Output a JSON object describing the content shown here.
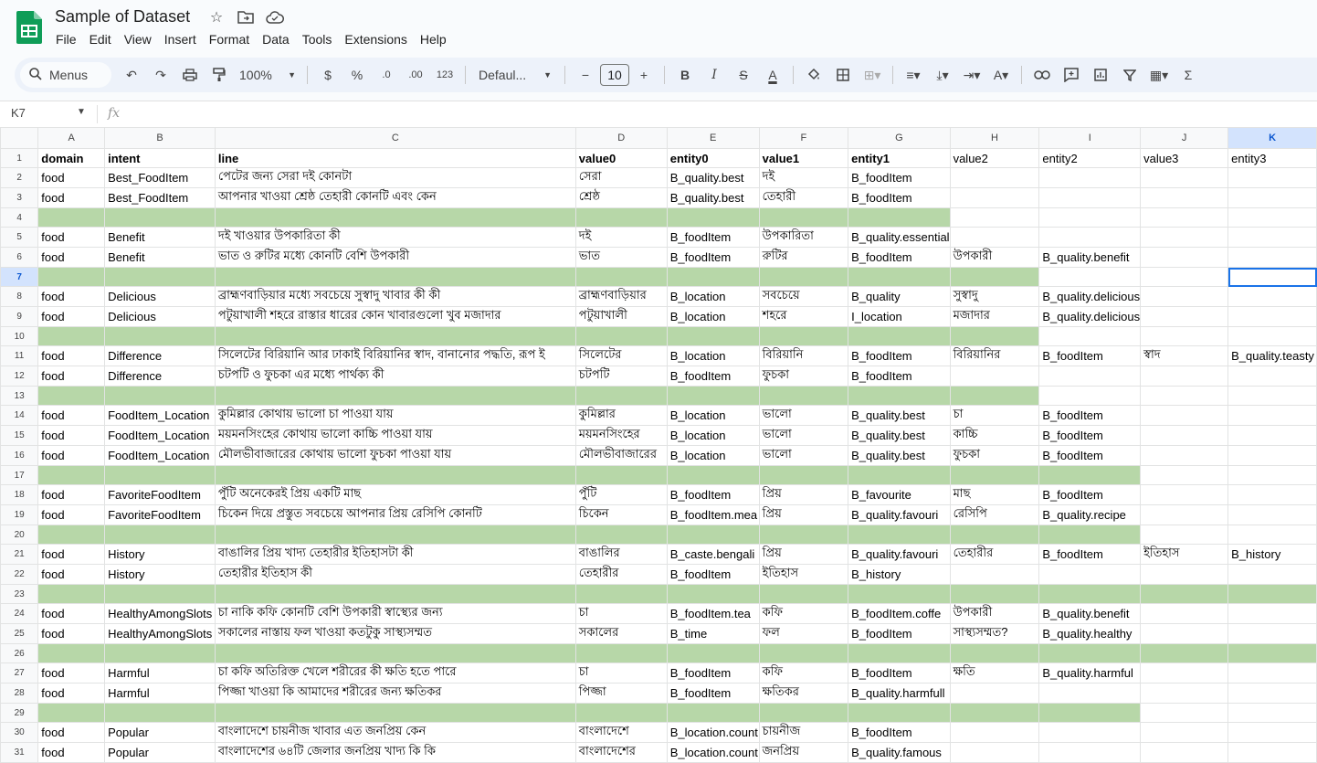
{
  "app": {
    "title": "Sample of Dataset",
    "menus": [
      "File",
      "Edit",
      "View",
      "Insert",
      "Format",
      "Data",
      "Tools",
      "Extensions",
      "Help"
    ]
  },
  "toolbar": {
    "search_label": "Menus",
    "zoom": "100%",
    "currency": "$",
    "percent": "%",
    "dec_decrease": ".0",
    "dec_increase": ".00",
    "number_format": "123",
    "font": "Defaul...",
    "font_size": "10",
    "bold": "B",
    "italic": "I",
    "strike": "S",
    "text_color": "A",
    "sum": "Σ"
  },
  "formula_bar": {
    "cell_ref": "K7",
    "fx": "fx",
    "value": ""
  },
  "grid": {
    "columns": [
      "A",
      "B",
      "C",
      "D",
      "E",
      "F",
      "G",
      "H",
      "I",
      "J",
      "K"
    ],
    "selected_column": "K",
    "selected_row": "7",
    "rows": [
      {
        "n": "1",
        "cells": [
          "domain",
          "intent",
          "line",
          "value0",
          "entity0",
          "value1",
          "entity1",
          "value2",
          "entity2",
          "value3",
          "entity3"
        ]
      },
      {
        "n": "2",
        "cells": [
          "food",
          "Best_FoodItem",
          "পেটের জন্য সেরা দই কোনটা",
          "সেরা",
          "B_quality.best",
          "দই",
          "B_foodItem",
          "",
          "",
          "",
          ""
        ]
      },
      {
        "n": "3",
        "cells": [
          "food",
          "Best_FoodItem",
          "আপনার খাওয়া শ্রেষ্ঠ তেহারী কোনটি এবং কেন",
          "শ্রেষ্ঠ",
          "B_quality.best",
          "তেহারী",
          "B_foodItem",
          "",
          "",
          "",
          ""
        ]
      },
      {
        "n": "4",
        "cells": [
          "",
          "",
          "",
          "",
          "",
          "",
          "",
          "",
          "",
          "",
          ""
        ]
      },
      {
        "n": "5",
        "cells": [
          "food",
          "Benefit",
          "দই খাওয়ার উপকারিতা কী",
          "দই",
          "B_foodItem",
          "উপকারিতা",
          "B_quality.essential",
          "",
          "",
          "",
          ""
        ]
      },
      {
        "n": "6",
        "cells": [
          "food",
          "Benefit",
          "ভাত ও রুটির মধ্যে কোনটি বেশি উপকারী",
          "ভাত",
          "B_foodItem",
          "রুটির",
          "B_foodItem",
          "উপকারী",
          "B_quality.benefit",
          "",
          ""
        ]
      },
      {
        "n": "7",
        "cells": [
          "",
          "",
          "",
          "",
          "",
          "",
          "",
          "",
          "",
          "",
          ""
        ]
      },
      {
        "n": "8",
        "cells": [
          "food",
          "Delicious",
          "ব্রাহ্মণবাড়িয়ার মধ্যে সবচেয়ে সুস্বাদু খাবার কী কী",
          "ব্রাহ্মণবাড়িয়ার",
          "B_location",
          "সবচেয়ে",
          "B_quality",
          "সুস্বাদু",
          "B_quality.delicious",
          "",
          ""
        ]
      },
      {
        "n": "9",
        "cells": [
          "food",
          "Delicious",
          "পটুয়াখালী শহরে রাস্তার ধারের কোন খাবারগুলো খুব মজাদার",
          "পটুয়াখালী",
          "B_location",
          "শহরে",
          "I_location",
          "মজাদার",
          "B_quality.delicious",
          "",
          ""
        ]
      },
      {
        "n": "10",
        "cells": [
          "",
          "",
          "",
          "",
          "",
          "",
          "",
          "",
          "",
          "",
          ""
        ]
      },
      {
        "n": "11",
        "cells": [
          "food",
          "Difference",
          "সিলেটের বিরিয়ানি আর ঢাকাই বিরিয়ানির স্বাদ, বানানোর পদ্ধতি, রূপ ই",
          "সিলেটের",
          "B_location",
          "বিরিয়ানি",
          "B_foodItem",
          "বিরিয়ানির",
          "B_foodItem",
          "স্বাদ",
          "B_quality.teasty"
        ]
      },
      {
        "n": "12",
        "cells": [
          "food",
          "Difference",
          "চটপটি ও ফুচকা এর মধ্যে পার্থক্য কী",
          "চটপটি",
          "B_foodItem",
          "ফুচকা",
          "B_foodItem",
          "",
          "",
          "",
          ""
        ]
      },
      {
        "n": "13",
        "cells": [
          "",
          "",
          "",
          "",
          "",
          "",
          "",
          "",
          "",
          "",
          ""
        ]
      },
      {
        "n": "14",
        "cells": [
          "food",
          "FoodItem_Location",
          "কুমিল্লার কোথায় ভালো চা পাওয়া যায়",
          "কুমিল্লার",
          "B_location",
          "ভালো",
          "B_quality.best",
          "চা",
          "B_foodItem",
          "",
          ""
        ]
      },
      {
        "n": "15",
        "cells": [
          "food",
          "FoodItem_Location",
          "ময়মনসিংহের কোথায় ভালো কাচ্চি পাওয়া যায়",
          "ময়মনসিংহের",
          "B_location",
          "ভালো",
          "B_quality.best",
          "কাচ্চি",
          "B_foodItem",
          "",
          ""
        ]
      },
      {
        "n": "16",
        "cells": [
          "food",
          "FoodItem_Location",
          "মৌলভীবাজারের কোথায় ভালো ফুচকা পাওয়া যায়",
          "মৌলভীবাজারের",
          "B_location",
          "ভালো",
          "B_quality.best",
          "ফুচকা",
          "B_foodItem",
          "",
          ""
        ]
      },
      {
        "n": "17",
        "cells": [
          "",
          "",
          "",
          "",
          "",
          "",
          "",
          "",
          "",
          "",
          ""
        ]
      },
      {
        "n": "18",
        "cells": [
          "food",
          "FavoriteFoodItem",
          "পুঁটি অনেকেরই প্রিয় একটি মাছ",
          "পুঁটি",
          "B_foodItem",
          "প্রিয়",
          "B_favourite",
          "মাছ",
          "B_foodItem",
          "",
          ""
        ]
      },
      {
        "n": "19",
        "cells": [
          "food",
          "FavoriteFoodItem",
          "চিকেন দিয়ে প্রস্তুত সবচেয়ে আপনার প্রিয় রেসিপি কোনটি",
          "চিকেন",
          "B_foodItem.mea",
          "প্রিয়",
          "B_quality.favouri",
          "রেসিপি",
          "B_quality.recipe",
          "",
          ""
        ]
      },
      {
        "n": "20",
        "cells": [
          "",
          "",
          "",
          "",
          "",
          "",
          "",
          "",
          "",
          "",
          ""
        ]
      },
      {
        "n": "21",
        "cells": [
          "food",
          "History",
          "বাঙালির প্রিয় খাদ্য তেহারীর ইতিহাসটা কী",
          "বাঙালির",
          "B_caste.bengali",
          "প্রিয়",
          "B_quality.favouri",
          "তেহারীর",
          "B_foodItem",
          "ইতিহাস",
          "B_history"
        ]
      },
      {
        "n": "22",
        "cells": [
          "food",
          "History",
          "তেহারীর ইতিহাস কী",
          "তেহারীর",
          "B_foodItem",
          "ইতিহাস",
          "B_history",
          "",
          "",
          "",
          ""
        ]
      },
      {
        "n": "23",
        "cells": [
          "",
          "",
          "",
          "",
          "",
          "",
          "",
          "",
          "",
          "",
          ""
        ]
      },
      {
        "n": "24",
        "cells": [
          "food",
          "HealthyAmongSlots",
          "চা নাকি কফি কোনটি বেশি উপকারী স্বাস্থ্যের জন্য",
          "চা",
          "B_foodItem.tea",
          "কফি",
          "B_foodItem.coffe",
          "উপকারী",
          "B_quality.benefit",
          "",
          ""
        ]
      },
      {
        "n": "25",
        "cells": [
          "food",
          "HealthyAmongSlots",
          "সকালের নাস্তায় ফল খাওয়া কতটুকু সাস্থ্যসম্মত",
          "সকালের",
          "B_time",
          "ফল",
          "B_foodItem",
          "সাস্থ্যসম্মত?",
          "B_quality.healthy",
          "",
          ""
        ]
      },
      {
        "n": "26",
        "cells": [
          "",
          "",
          "",
          "",
          "",
          "",
          "",
          "",
          "",
          "",
          ""
        ]
      },
      {
        "n": "27",
        "cells": [
          "food",
          "Harmful",
          "চা কফি অতিরিক্ত খেলে শরীরের কী ক্ষতি হতে পারে",
          "চা",
          "B_foodItem",
          "কফি",
          "B_foodItem",
          "ক্ষতি",
          "B_quality.harmful",
          "",
          ""
        ]
      },
      {
        "n": "28",
        "cells": [
          "food",
          "Harmful",
          "পিজ্জা খাওয়া কি আমাদের শরীরের জন্য ক্ষতিকর",
          "পিজ্জা",
          "B_foodItem",
          "ক্ষতিকর",
          "B_quality.harmfull",
          "",
          "",
          "",
          ""
        ]
      },
      {
        "n": "29",
        "cells": [
          "",
          "",
          "",
          "",
          "",
          "",
          "",
          "",
          "",
          "",
          ""
        ]
      },
      {
        "n": "30",
        "cells": [
          "food",
          "Popular",
          "বাংলাদেশে চায়নীজ খাবার এত জনপ্রিয় কেন",
          "বাংলাদেশে",
          "B_location.count",
          "চায়নীজ",
          "B_foodItem",
          "",
          "",
          "",
          ""
        ]
      },
      {
        "n": "31",
        "cells": [
          "food",
          "Popular",
          "বাংলাদেশের ৬৪টি জেলার জনপ্রিয় খাদ্য কি কি",
          "বাংলাদেশের",
          "B_location.count",
          "জনপ্রিয়",
          "B_quality.famous",
          "",
          "",
          "",
          ""
        ]
      }
    ]
  },
  "colors": {
    "separator_fill": "#b7d7a8",
    "selection": "#1a73e8"
  }
}
